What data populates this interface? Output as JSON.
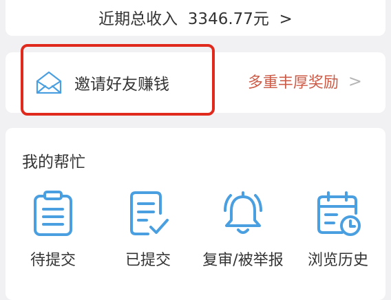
{
  "income": {
    "label": "近期总收入",
    "amount": "3346.77元",
    "chevron": ">"
  },
  "invite": {
    "label": "邀请好友赚钱",
    "reward": "多重丰厚奖励",
    "chevron": ">",
    "icon": "envelope-icon"
  },
  "help": {
    "title": "我的帮忙",
    "items": [
      {
        "label": "待提交",
        "icon": "clipboard-icon"
      },
      {
        "label": "已提交",
        "icon": "document-check-icon"
      },
      {
        "label": "复审/被举报",
        "icon": "bell-icon"
      },
      {
        "label": "浏览历史",
        "icon": "calendar-clock-icon"
      }
    ]
  },
  "colors": {
    "icon_blue": "#4a9fe0",
    "reward_red": "#cc5b47",
    "highlight_red": "#e02a1e"
  }
}
